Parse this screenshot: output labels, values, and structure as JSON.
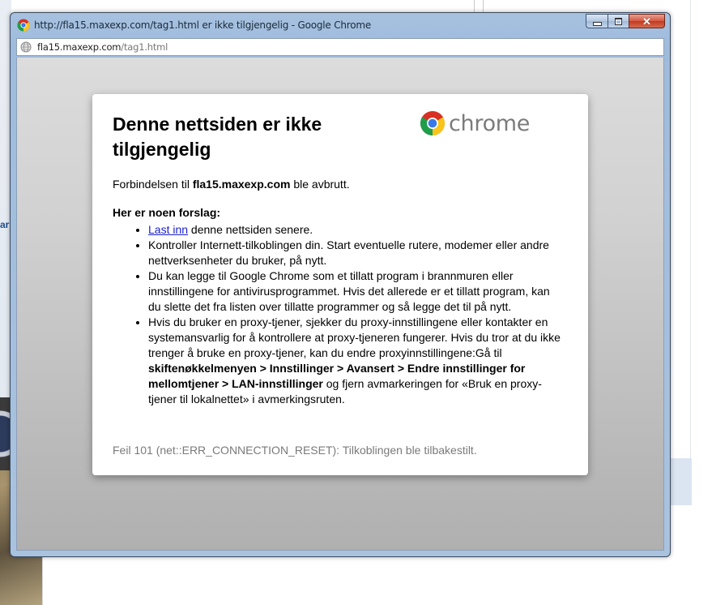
{
  "window": {
    "title": "http://fla15.maxexp.com/tag1.html er ikke tilgjengelig - Google Chrome",
    "close_glyph": "✕"
  },
  "address": {
    "host": "fla15.maxexp.com",
    "path": "/tag1.html"
  },
  "background": {
    "left_fragment_text": "ar"
  },
  "error_page": {
    "heading": "Denne nettsiden er ikke tilgjengelig",
    "logo_text": "chrome",
    "intro_before": "Forbindelsen til ",
    "intro_host": "fla15.maxexp.com",
    "intro_after": " ble avbrutt.",
    "suggestions_title": "Her er noen forslag:",
    "suggestions": {
      "reload_link": "Last inn",
      "reload_rest": " denne nettsiden senere.",
      "check_connection": "Kontroller Internett-tilkoblingen din. Start eventuelle rutere, modemer eller andre nettverksenheter du bruker, på nytt.",
      "firewall": "Du kan legge til Google Chrome som et tillatt program i brannmuren eller innstillingene for antivirusprogrammet. Hvis det allerede er et tillatt program, kan du slette det fra listen over tillatte programmer og så legge det til på nytt.",
      "proxy_before": "Hvis du bruker en proxy-tjener, sjekker du proxy-innstillingene eller kontakter en systemansvarlig for å kontrollere at proxy-tjeneren fungerer. Hvis du tror at du ikke trenger å bruke en proxy-tjener, kan du endre proxyinnstillingene:Gå til ",
      "proxy_path": "skiftenøkkelmenyen > Innstillinger > Avansert > Endre innstillinger for mellomtjener > LAN-innstillinger",
      "proxy_after": " og fjern avmarkeringen for «Bruk en proxy-tjener til lokalnettet» i avmerkingsruten."
    },
    "error_text": "Feil 101 (net::ERR_CONNECTION_RESET): Tilkoblingen ble tilbakestilt."
  },
  "colors": {
    "link": "#1a1fcc",
    "error_text": "#7a7a7a",
    "titlebar": "#a7c2e0"
  }
}
